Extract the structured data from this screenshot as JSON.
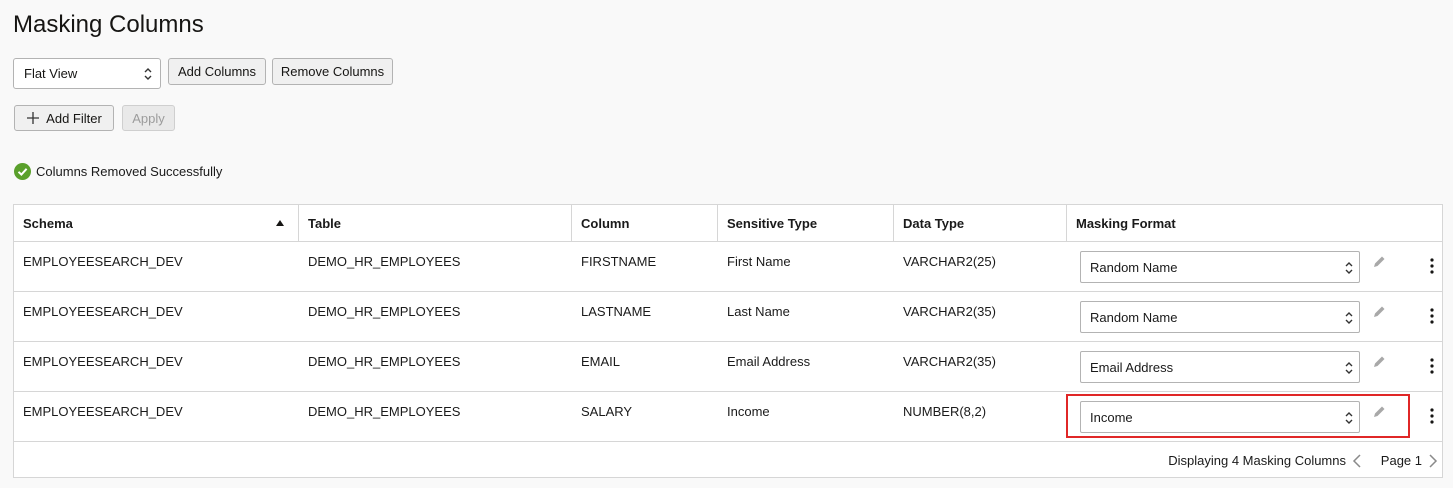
{
  "page": {
    "title": "Masking Columns"
  },
  "toolbar": {
    "view_select": "Flat View",
    "add_columns": "Add Columns",
    "remove_columns": "Remove Columns",
    "add_filter": "Add Filter",
    "apply": "Apply"
  },
  "message": {
    "text": "Columns Removed Successfully",
    "color": "#5aa02c"
  },
  "table": {
    "headers": [
      "Schema",
      "Table",
      "Column",
      "Sensitive Type",
      "Data Type",
      "Masking Format"
    ],
    "rows": [
      {
        "schema": "EMPLOYEESEARCH_DEV",
        "table": "DEMO_HR_EMPLOYEES",
        "column": "FIRSTNAME",
        "sensitive_type": "First Name",
        "data_type": "VARCHAR2(25)",
        "masking_format": "Random Name"
      },
      {
        "schema": "EMPLOYEESEARCH_DEV",
        "table": "DEMO_HR_EMPLOYEES",
        "column": "LASTNAME",
        "sensitive_type": "Last Name",
        "data_type": "VARCHAR2(35)",
        "masking_format": "Random Name"
      },
      {
        "schema": "EMPLOYEESEARCH_DEV",
        "table": "DEMO_HR_EMPLOYEES",
        "column": "EMAIL",
        "sensitive_type": "Email Address",
        "data_type": "VARCHAR2(35)",
        "masking_format": "Email Address"
      },
      {
        "schema": "EMPLOYEESEARCH_DEV",
        "table": "DEMO_HR_EMPLOYEES",
        "column": "SALARY",
        "sensitive_type": "Income",
        "data_type": "NUMBER(8,2)",
        "masking_format": "Income"
      }
    ]
  },
  "pagination": {
    "summary": "Displaying 4 Masking Columns",
    "page": "Page 1"
  },
  "colors": {
    "highlight": "#e02727",
    "accent": "#5aa02c"
  }
}
